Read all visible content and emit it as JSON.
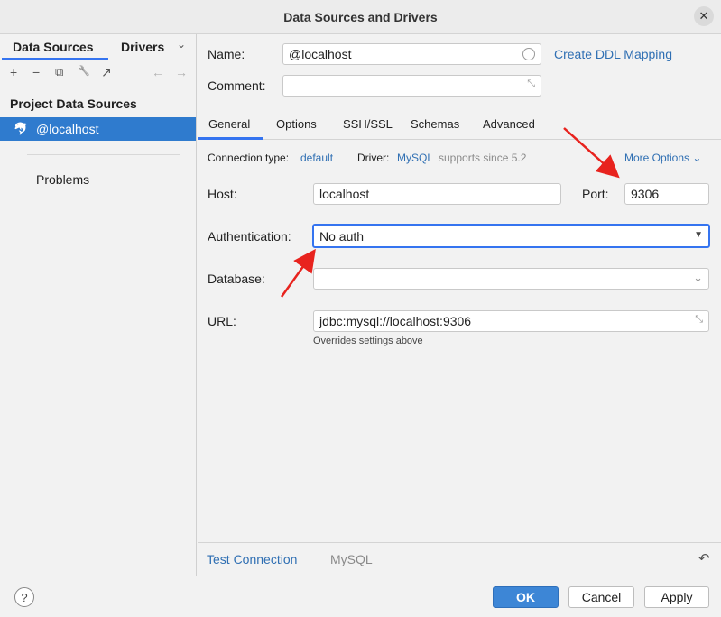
{
  "window": {
    "title": "Data Sources and Drivers",
    "close_glyph": "✕"
  },
  "sidebar": {
    "tabs": [
      {
        "label": "Data Sources"
      },
      {
        "label": "Drivers"
      }
    ],
    "tabs_dropdown": "⌄",
    "toolbar": [
      {
        "icon": "add-icon",
        "glyph": "+"
      },
      {
        "icon": "remove-icon",
        "glyph": "−"
      },
      {
        "icon": "duplicate-icon",
        "glyph": "⧉"
      },
      {
        "icon": "wrench-icon",
        "glyph": "🔧"
      },
      {
        "icon": "jump-icon",
        "glyph": "↗"
      },
      {
        "icon": "back-icon",
        "glyph": "←"
      },
      {
        "icon": "forward-icon",
        "glyph": "→"
      }
    ],
    "section_title": "Project Data Sources",
    "selected_source": {
      "label": "@localhost",
      "icon": "mysql-dolphin-icon",
      "glyph": "🐬"
    },
    "problems_label": "Problems"
  },
  "form": {
    "name_label": "Name:",
    "name_value": "@localhost",
    "create_ddl_link": "Create DDL Mapping",
    "comment_label": "Comment:",
    "comment_value": "",
    "tabs": [
      {
        "label": "General"
      },
      {
        "label": "Options"
      },
      {
        "label": "SSH/SSL"
      },
      {
        "label": "Schemas"
      },
      {
        "label": "Advanced"
      }
    ],
    "connection_type_label": "Connection type:",
    "connection_type_value": "default",
    "driver_label": "Driver:",
    "driver_value": "MySQL",
    "driver_note": "supports since 5.2",
    "more_options": "More Options ⌄",
    "host_label": "Host:",
    "host_value": "localhost",
    "port_label": "Port:",
    "port_value": "9306",
    "auth_label": "Authentication:",
    "auth_value": "No auth",
    "database_label": "Database:",
    "database_value": "",
    "url_label": "URL:",
    "url_value": "jdbc:mysql://localhost:9306",
    "url_hint": "Overrides settings above",
    "test_connection": "Test Connection",
    "driver_footer": "MySQL",
    "revert_glyph": "↶"
  },
  "footer": {
    "help_glyph": "?",
    "ok_label": "OK",
    "cancel_label": "Cancel",
    "apply_label": "Apply"
  },
  "colors": {
    "accent": "#3574f0",
    "selection": "#2f7bce",
    "link": "#2f6fb3",
    "annotation_arrow": "#e8231e"
  }
}
